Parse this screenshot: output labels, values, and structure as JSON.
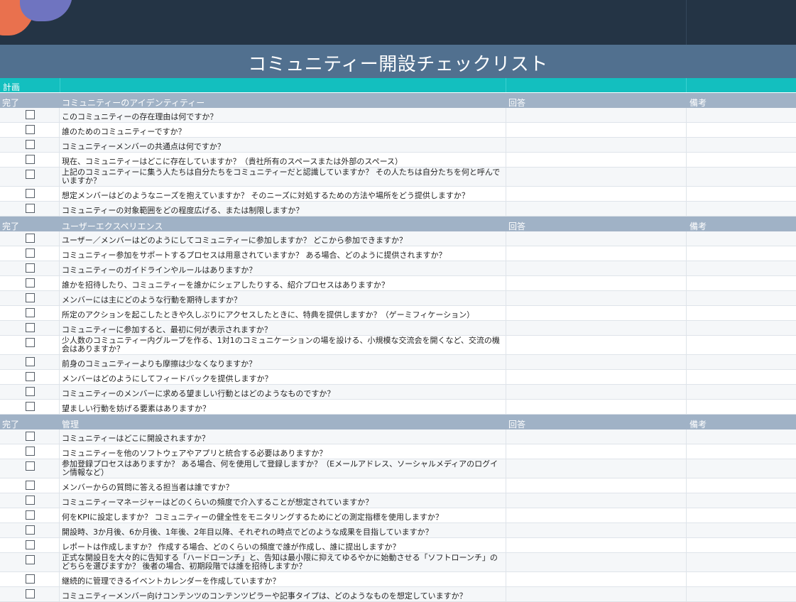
{
  "title": "コミュニティー開設チェックリスト",
  "plan_label": "計画",
  "sections": [
    {
      "done": "完了",
      "name": "コミュニティーのアイデンティティー",
      "answer": "回答",
      "notes": "備考",
      "questions": [
        "このコミュニティーの存在理由は何ですか？",
        "誰のためのコミュニティーですか？",
        "コミュニティーメンバーの共通点は何ですか？",
        "現在、コミュニティーはどこに存在していますか？（貴社所有のスペースまたは外部のスペース）",
        "上記のコミュニティーに集う人たちは自分たちをコミュニティーだと認識していますか？ その人たちは自分たちを何と呼んでいますか？",
        "想定メンバーはどのようなニーズを抱えていますか？ そのニーズに対処するための方法や場所をどう提供しますか？",
        "コミュニティーの対象範囲をどの程度広げる、または制限しますか？"
      ]
    },
    {
      "done": "完了",
      "name": "ユーザーエクスペリエンス",
      "answer": "回答",
      "notes": "備考",
      "questions": [
        "ユーザー／メンバーはどのようにしてコミュニティーに参加しますか？ どこから参加できますか？",
        "コミュニティー参加をサポートするプロセスは用意されていますか？ ある場合、どのように提供されますか？",
        "コミュニティーのガイドラインやルールはありますか？",
        "誰かを招待したり、コミュニティーを誰かにシェアしたりする、紹介プロセスはありますか？",
        "メンバーには主にどのような行動を期待しますか？",
        "所定のアクションを起こしたときや久しぶりにアクセスしたときに、特典を提供しますか？（ゲーミフィケーション）",
        "コミュニティーに参加すると、最初に何が表示されますか？",
        "少人数のコミュニティー内グループを作る、1対1のコミュニケーションの場を設ける、小規模な交流会を開くなど、交流の機会はありますか？",
        "前身のコミュニティーよりも摩擦は少なくなりますか？",
        "メンバーはどのようにしてフィードバックを提供しますか？",
        "コミュニティーのメンバーに求める望ましい行動とはどのようなものですか？",
        "望ましい行動を妨げる要素はありますか？"
      ]
    },
    {
      "done": "完了",
      "name": "管理",
      "answer": "回答",
      "notes": "備考",
      "questions": [
        "コミュニティーはどこに開設されますか？",
        "コミュニティーを他のソフトウェアやアプリと統合する必要はありますか？",
        "参加登録プロセスはありますか？ ある場合、何を使用して登録しますか？（Eメールアドレス、ソーシャルメディアのログイン情報など）",
        "メンバーからの質問に答える担当者は誰ですか？",
        "コミュニティーマネージャーはどのくらいの頻度で介入することが想定されていますか？",
        "何をKPIに設定しますか？ コミュニティーの健全性をモニタリングするためにどの測定指標を使用しますか？",
        "開設時、3か月後、6か月後、1年後、2年目以降、それぞれの時点でどのような成果を目指していますか？",
        "レポートは作成しますか？ 作成する場合、どのくらいの頻度で誰が作成し、誰に提出しますか？",
        "正式な開設日を大々的に告知する「ハードローンチ」と、告知は最小限に抑えてゆるやかに始動させる「ソフトローンチ」のどちらを選びますか？ 後者の場合、初期段階では誰を招待しますか？",
        "継続的に管理できるイベントカレンダーを作成していますか？",
        "コミュニティーメンバー向けコンテンツのコンテンツピラーや記事タイプは、どのようなものを想定していますか？"
      ]
    }
  ]
}
